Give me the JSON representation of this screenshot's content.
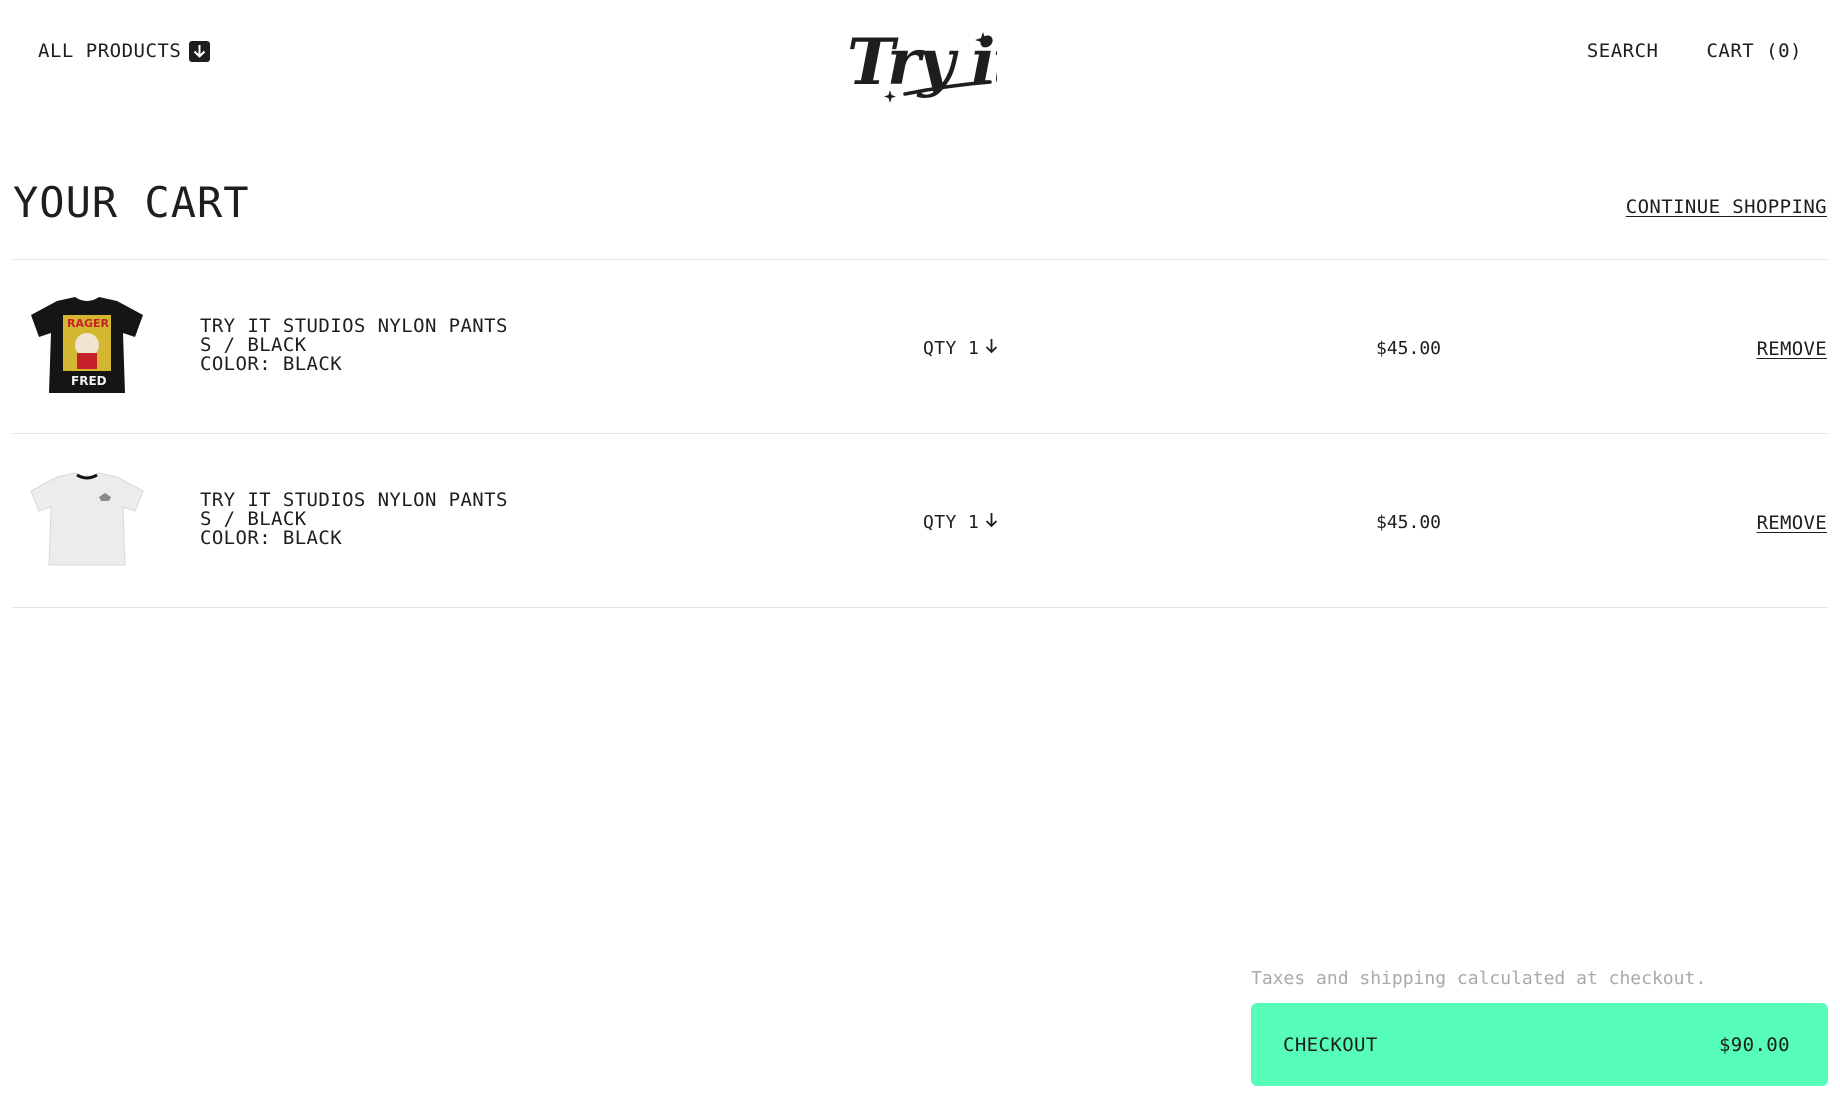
{
  "header": {
    "all_products_label": "ALL PRODUCTS",
    "logo_text": "Try it",
    "search_label": "SEARCH",
    "cart_label": "CART (0)"
  },
  "page": {
    "title": "YOUR CART",
    "continue_label": "CONTINUE SHOPPING"
  },
  "cart_items": [
    {
      "name": "TRY IT STUDIOS NYLON PANTS",
      "variant": "S / BLACK",
      "color": "COLOR: BLACK",
      "qty_label": "QTY 1",
      "price": "$45.00",
      "remove_label": "REMOVE",
      "thumb_text_top": "RAGER",
      "thumb_text_bottom": "FRED",
      "shirt_color": "#151515"
    },
    {
      "name": "TRY IT STUDIOS NYLON PANTS",
      "variant": "S / BLACK",
      "color": "COLOR: BLACK",
      "qty_label": "QTY 1",
      "price": "$45.00",
      "remove_label": "REMOVE",
      "shirt_color": "#ececec"
    }
  ],
  "checkout": {
    "tax_note": "Taxes and shipping calculated at checkout.",
    "button_label": "CHECKOUT",
    "total": "$90.00",
    "accent_color": "#56fdb9"
  }
}
